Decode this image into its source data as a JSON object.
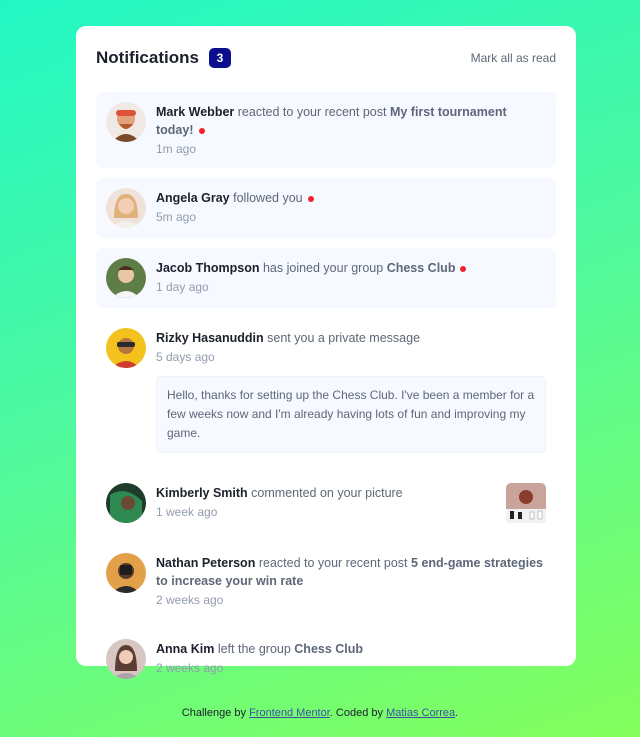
{
  "header": {
    "title": "Notifications",
    "count": "3",
    "mark_all": "Mark all as read"
  },
  "notifications": [
    {
      "name": "Mark Webber",
      "action": "reacted to your recent post",
      "target": "My first tournament today!",
      "time": "1m ago",
      "unread": true,
      "avatar_color": "#e58a54"
    },
    {
      "name": "Angela Gray",
      "action": "followed you",
      "time": "5m ago",
      "unread": true,
      "avatar_color": "#e8b69a"
    },
    {
      "name": "Jacob Thompson",
      "action": "has joined your group",
      "target": "Chess Club",
      "time": "1 day ago",
      "unread": true,
      "avatar_color": "#6f8f5b"
    },
    {
      "name": "Rizky Hasanuddin",
      "action": "sent you a private message",
      "time": "5 days ago",
      "unread": false,
      "message": "Hello, thanks for setting up the Chess Club. I've been a member for a few weeks now and I'm already having lots of fun and improving my game.",
      "avatar_color": "#f2c320"
    },
    {
      "name": "Kimberly Smith",
      "action": "commented on your picture",
      "time": "1 week ago",
      "unread": false,
      "avatar_color": "#2f7a4a"
    },
    {
      "name": "Nathan Peterson",
      "action": "reacted to your recent post",
      "target": "5 end-game strategies to increase your win rate",
      "time": "2 weeks ago",
      "unread": false,
      "avatar_color": "#e2a24b"
    },
    {
      "name": "Anna Kim",
      "action": "left the group",
      "target": "Chess Club",
      "time": "2 weeks ago",
      "unread": false,
      "avatar_color": "#c9b1a9"
    }
  ],
  "footer": {
    "prefix": "Challenge by",
    "link1": "Frontend Mentor",
    "middle": ". Coded by",
    "link2": "Matias Correa",
    "suffix": "."
  }
}
